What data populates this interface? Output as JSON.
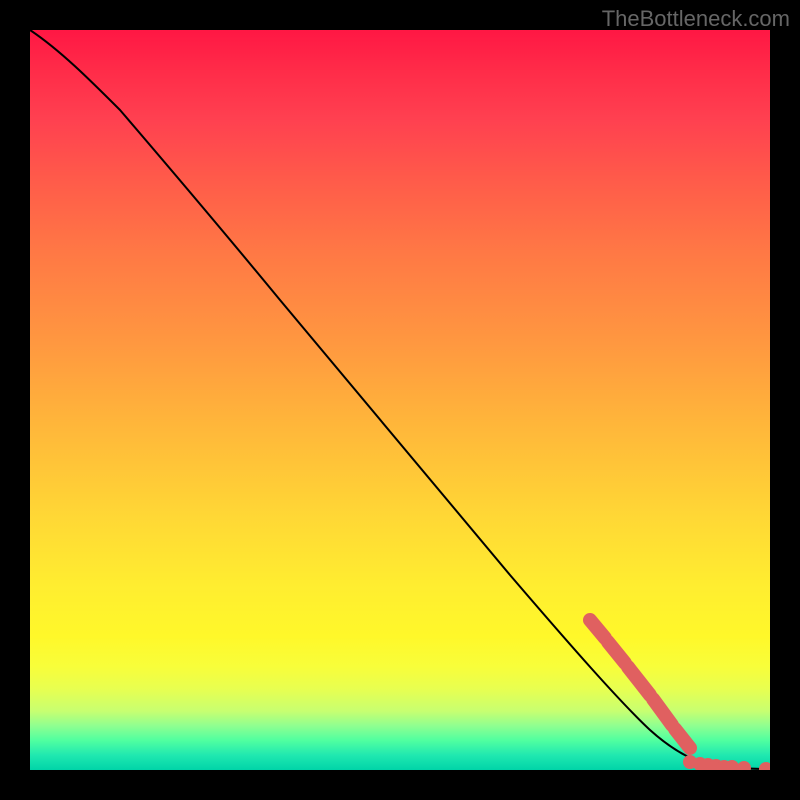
{
  "watermark": "TheBottleneck.com",
  "chart_data": {
    "type": "line",
    "title": "",
    "xlabel": "",
    "ylabel": "",
    "xlim": [
      0,
      100
    ],
    "ylim": [
      0,
      100
    ],
    "grid": false,
    "legend": false,
    "series": [
      {
        "name": "bottleneck-curve",
        "x": [
          0,
          5,
          10,
          20,
          30,
          40,
          50,
          60,
          70,
          78,
          82,
          86,
          88,
          90,
          92,
          94,
          96,
          98,
          100
        ],
        "y": [
          100,
          97,
          92,
          82,
          71,
          60,
          50,
          39,
          28,
          17,
          12,
          7,
          4,
          2,
          1,
          0.5,
          0.3,
          0.2,
          0.1
        ]
      }
    ],
    "highlighted_points": {
      "name": "marker-points",
      "x": [
        76,
        77,
        78,
        79,
        80,
        81,
        82,
        83,
        84,
        85,
        86,
        87,
        88,
        89,
        90,
        91,
        92,
        93,
        95,
        97,
        99
      ],
      "y": [
        20,
        19,
        17,
        16,
        15,
        13,
        12,
        10,
        9,
        8,
        7,
        5,
        4,
        3,
        2,
        1.5,
        1,
        0.8,
        0.5,
        0.3,
        0.2
      ]
    },
    "gradient": {
      "description": "vertical gradient from red (top) through orange, yellow to green (bottom)",
      "stops": [
        "#ff1744",
        "#ff7845",
        "#ffd835",
        "#fff82a",
        "#00d4a8"
      ]
    }
  }
}
